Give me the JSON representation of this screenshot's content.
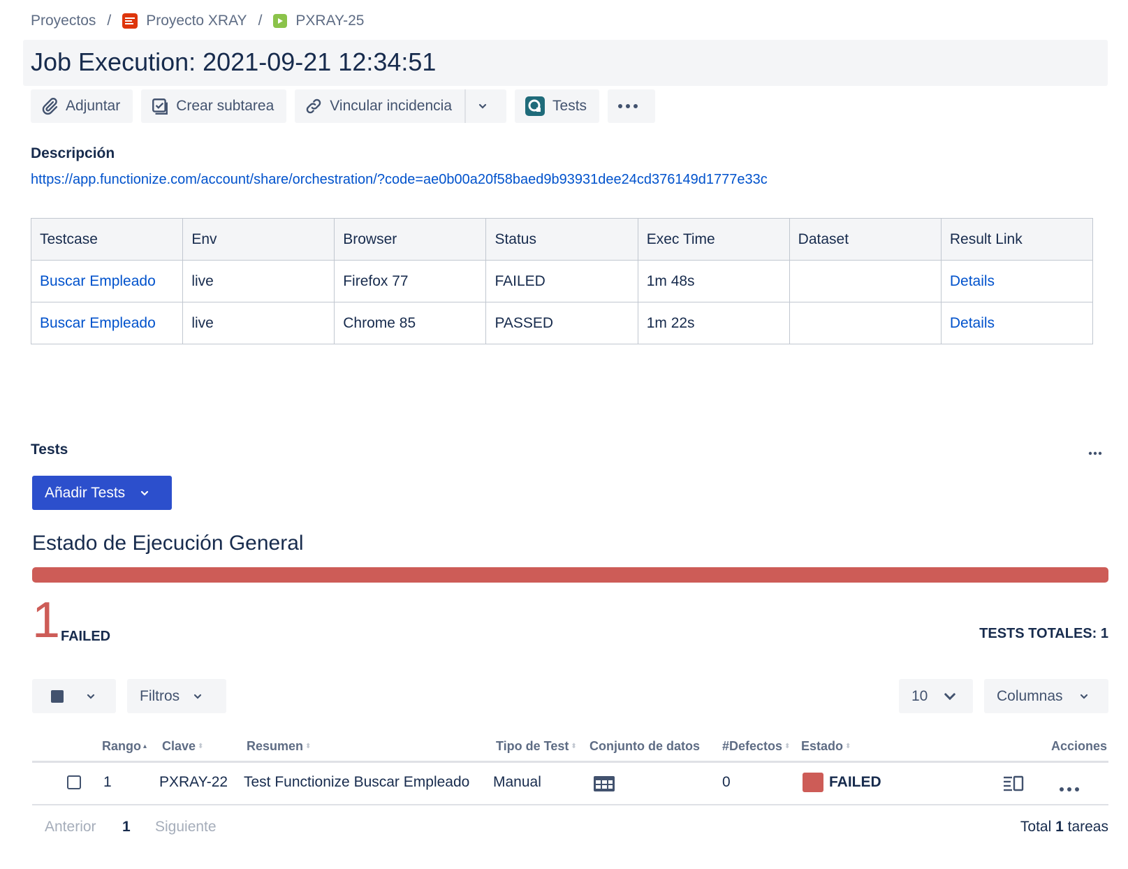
{
  "breadcrumb": {
    "projects": "Proyectos",
    "project": "Proyecto XRAY",
    "issue": "PXRAY-25"
  },
  "title": "Job Execution: 2021-09-21 12:34:51",
  "toolbar": {
    "attach": "Adjuntar",
    "subtask": "Crear subtarea",
    "link": "Vincular incidencia",
    "tests": "Tests"
  },
  "description": {
    "label": "Descripción",
    "url": "https://app.functionize.com/account/share/orchestration/?code=ae0b00a20f58baed9b93931dee24cd376149d1777e33c"
  },
  "exec_table": {
    "headers": [
      "Testcase",
      "Env",
      "Browser",
      "Status",
      "Exec Time",
      "Dataset",
      "Result Link"
    ],
    "rows": [
      {
        "testcase": "Buscar Empleado",
        "env": "live",
        "browser": "Firefox 77",
        "status": "FAILED",
        "exec_time": "1m 48s",
        "dataset": "",
        "result": "Details"
      },
      {
        "testcase": "Buscar Empleado",
        "env": "live",
        "browser": "Chrome 85",
        "status": "PASSED",
        "exec_time": "1m 22s",
        "dataset": "",
        "result": "Details"
      }
    ]
  },
  "tests_section": {
    "label": "Tests",
    "add_button": "Añadir Tests",
    "status_heading": "Estado de Ejecución General",
    "status_progress": {
      "failed_fraction": 1.0
    },
    "failed_count": "1",
    "failed_label": "FAILED",
    "totals": "TESTS TOTALES: 1"
  },
  "controls": {
    "filters": "Filtros",
    "page_size": "10",
    "columns": "Columnas"
  },
  "test_table": {
    "headers": {
      "rank": "Rango",
      "key": "Clave",
      "summary": "Resumen",
      "type": "Tipo de Test",
      "dataset": "Conjunto de datos",
      "defects": "#Defectos",
      "state": "Estado",
      "actions": "Acciones"
    },
    "rows": [
      {
        "rank": "1",
        "key": "PXRAY-22",
        "summary": "Test Functionize Buscar Empleado",
        "type": "Manual",
        "defects": "0",
        "state": "FAILED"
      }
    ]
  },
  "pagination": {
    "prev": "Anterior",
    "current": "1",
    "next": "Siguiente",
    "total_prefix": "Total",
    "total_count": "1",
    "total_suffix": "tareas"
  },
  "colors": {
    "accent": "#2c4fcc",
    "failed": "#cd5c57",
    "passed": "#36b37e",
    "link": "#0052cc"
  },
  "icons": [
    "project-icon",
    "issue-type-icon",
    "paperclip-icon",
    "checkbox-icon",
    "link-icon",
    "chevron-down-icon",
    "tests-app-icon",
    "more-icon",
    "dataset-grid-icon",
    "details-view-icon"
  ]
}
